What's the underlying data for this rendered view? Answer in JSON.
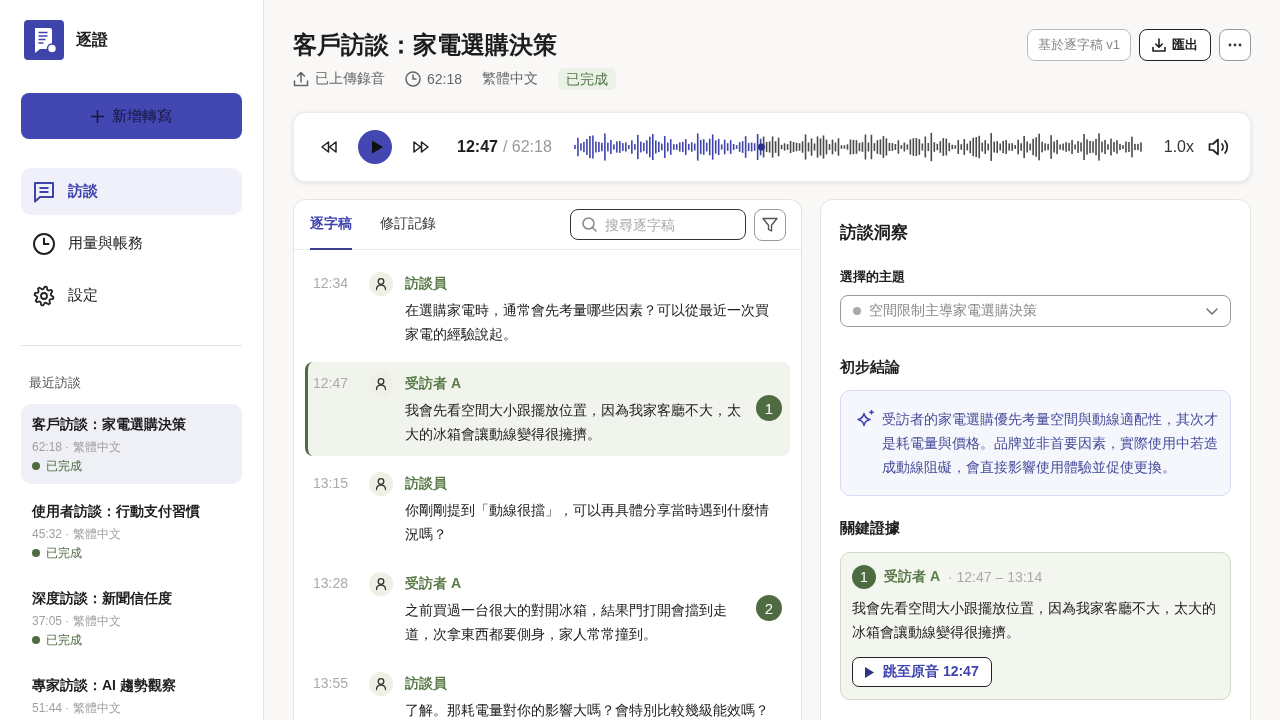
{
  "app": {
    "name": "逐證"
  },
  "new_button": {
    "label": "新增轉寫"
  },
  "nav": [
    {
      "kind": "chat",
      "label": "訪談",
      "selected": true
    },
    {
      "kind": "clock",
      "label": "用量與帳務",
      "selected": false
    },
    {
      "kind": "gear",
      "label": "設定",
      "selected": false
    }
  ],
  "recent": {
    "heading": "最近訪談",
    "items": [
      {
        "title": "客戶訪談：家電選購決策",
        "meta": "62:18 · 繁體中文",
        "status": "已完成",
        "selected": true
      },
      {
        "title": "使用者訪談：行動支付習慣",
        "meta": "45:32 · 繁體中文",
        "status": "已完成",
        "selected": false
      },
      {
        "title": "深度訪談：新聞信任度",
        "meta": "37:05 · 繁體中文",
        "status": "已完成",
        "selected": false
      },
      {
        "title": "專家訪談：AI 趨勢觀察",
        "meta": "51:44 · 繁體中文",
        "selected": false
      }
    ]
  },
  "header": {
    "title": "客戶訪談：家電選購決策",
    "meta": [
      {
        "kind": "upload",
        "text": "已上傳錄音"
      },
      {
        "kind": "duration",
        "text": "62:18"
      },
      {
        "kind": "plain",
        "text": "繁體中文"
      },
      {
        "kind": "badge",
        "text": "已完成"
      }
    ],
    "actions": [
      {
        "kind": "version",
        "label": "基於逐字稿 v1"
      },
      {
        "kind": "export",
        "label": "匯出"
      },
      {
        "kind": "more"
      }
    ]
  },
  "player": {
    "current": "12:47",
    "total": "/ 62:18",
    "level": 0.33,
    "speed": "1.0x"
  },
  "transcript": {
    "tabs": [
      {
        "label": "逐字稿",
        "selected": true
      },
      {
        "label": "修訂記錄",
        "selected": false
      }
    ],
    "search": {
      "placeholder": "搜尋逐字稿"
    },
    "segments": [
      {
        "time": "12:34",
        "speaker": "訪談員",
        "text": "在選購家電時，通常會先考量哪些因素？可以從最近一次買家電的經驗說起。",
        "selected": false
      },
      {
        "time": "12:47",
        "speaker": "受訪者 A",
        "text": "我會先看空間大小跟擺放位置，因為我家客廳不大，太大的冰箱會讓動線變得很擁擠。",
        "selected": true,
        "evidence": "1"
      },
      {
        "time": "13:15",
        "speaker": "訪談員",
        "text": "你剛剛提到「動線很擋」，可以再具體分享當時遇到什麼情況嗎？",
        "selected": false
      },
      {
        "time": "13:28",
        "speaker": "受訪者 A",
        "text": "之前買過一台很大的對開冰箱，結果門打開會擋到走道，次拿東西都要側身，家人常常撞到。",
        "selected": false,
        "evidence": "2"
      },
      {
        "time": "13:55",
        "speaker": "訪談員",
        "text": "了解。那耗電量對你的影響大嗎？會特別比較幾級能效嗎？",
        "selected": false
      }
    ]
  },
  "insights": {
    "title": "訪談洞察",
    "topic": {
      "label": "選擇的主題",
      "value": "空間限制主導家電選購決策"
    },
    "conclusion": {
      "heading": "初步結論",
      "text": "受訪者的家電選購優先考量空間與動線適配性，其次才是耗電量與價格。品牌並非首要因素，實際使用中若造成動線阻礙，會直接影響使用體驗並促使更換。"
    },
    "evidence": {
      "heading": "關鍵證據",
      "items": [
        {
          "number": "1",
          "speaker": "受訪者 A",
          "range": "· 12:47 – 13:14",
          "quote": "我會先看空間大小跟擺放位置，因為我家客廳不大，太大的冰箱會讓動線變得很擁擠。",
          "button": "跳至原音 12:47"
        }
      ]
    }
  }
}
